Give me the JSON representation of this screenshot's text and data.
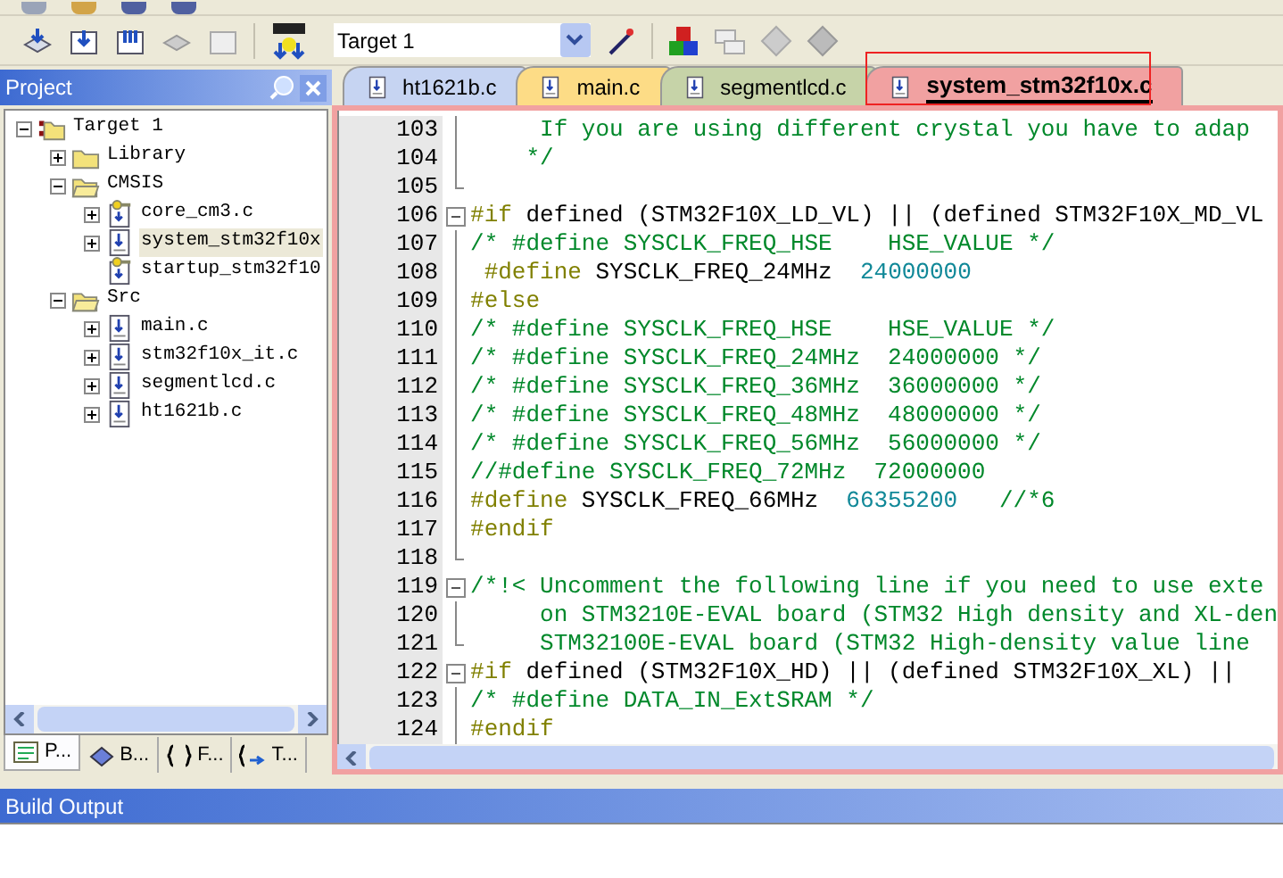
{
  "toolbar": {
    "target_select": {
      "value": "Target 1"
    }
  },
  "project_panel": {
    "title": "Project",
    "tree": [
      {
        "label": "Target 1",
        "kind": "target",
        "expanded": true,
        "selected": false,
        "children": [
          {
            "label": "Library",
            "kind": "folder",
            "expanded": false,
            "selected": false
          },
          {
            "label": "CMSIS",
            "kind": "folder",
            "expanded": true,
            "selected": false,
            "children": [
              {
                "label": "core_cm3.c",
                "kind": "file_options",
                "expanded": false,
                "selected": false
              },
              {
                "label": "system_stm32f10x",
                "kind": "file",
                "expanded": false,
                "selected": true
              },
              {
                "label": "startup_stm32f10",
                "kind": "file_options",
                "selected": false
              }
            ]
          },
          {
            "label": "Src",
            "kind": "folder",
            "expanded": true,
            "selected": false,
            "children": [
              {
                "label": "main.c",
                "kind": "file",
                "expanded": false,
                "selected": false
              },
              {
                "label": "stm32f10x_it.c",
                "kind": "file",
                "expanded": false,
                "selected": false
              },
              {
                "label": "segmentlcd.c",
                "kind": "file",
                "expanded": false,
                "selected": false
              },
              {
                "label": "ht1621b.c",
                "kind": "file",
                "expanded": false,
                "selected": false
              }
            ]
          }
        ]
      }
    ],
    "tabs": [
      {
        "label": "P...",
        "kind": "project",
        "selected": true
      },
      {
        "label": "B...",
        "kind": "books",
        "selected": false
      },
      {
        "label": "F...",
        "kind": "functions",
        "selected": false
      },
      {
        "label": "T...",
        "kind": "templates",
        "selected": false
      }
    ]
  },
  "editor": {
    "tabs": [
      {
        "label": "ht1621b.c",
        "color": "#c6d4f2",
        "selected": false
      },
      {
        "label": "main.c",
        "color": "#fddc86",
        "selected": false
      },
      {
        "label": "segmentlcd.c",
        "color": "#c6d3a8",
        "selected": false
      },
      {
        "label": "system_stm32f10x.c",
        "color": "#f1a1a1",
        "selected": true
      }
    ],
    "lines": [
      {
        "number": "103",
        "kind": "bar",
        "segments": [
          {
            "kind": "comment",
            "text": "     If you are using different crystal you have to adap"
          }
        ]
      },
      {
        "number": "104",
        "kind": "bar",
        "segments": [
          {
            "kind": "comment",
            "text": "    */"
          }
        ]
      },
      {
        "number": "105",
        "kind": "end"
      },
      {
        "number": "106",
        "kind": "open",
        "segments": [
          {
            "kind": "pp",
            "text": "#if"
          },
          {
            "kind": "plain",
            "text": " defined (STM32F10X_LD_VL) || (defined STM32F10X_MD_VL"
          }
        ]
      },
      {
        "number": "107",
        "kind": "bar",
        "segments": [
          {
            "kind": "comment",
            "text": "/* #define SYSCLK_FREQ_HSE    HSE_VALUE */"
          }
        ]
      },
      {
        "number": "108",
        "kind": "bar",
        "segments": [
          {
            "kind": "pp",
            "text": " #define"
          },
          {
            "kind": "plain",
            "text": " SYSCLK_FREQ_24MHz  "
          },
          {
            "kind": "num",
            "text": "24000000"
          }
        ]
      },
      {
        "number": "109",
        "kind": "bar",
        "segments": [
          {
            "kind": "pp",
            "text": "#else"
          }
        ]
      },
      {
        "number": "110",
        "kind": "bar",
        "segments": [
          {
            "kind": "comment",
            "text": "/* #define SYSCLK_FREQ_HSE    HSE_VALUE */"
          }
        ]
      },
      {
        "number": "111",
        "kind": "bar",
        "segments": [
          {
            "kind": "comment",
            "text": "/* #define SYSCLK_FREQ_24MHz  24000000 */"
          }
        ]
      },
      {
        "number": "112",
        "kind": "bar",
        "segments": [
          {
            "kind": "comment",
            "text": "/* #define SYSCLK_FREQ_36MHz  36000000 */"
          }
        ]
      },
      {
        "number": "113",
        "kind": "bar",
        "segments": [
          {
            "kind": "comment",
            "text": "/* #define SYSCLK_FREQ_48MHz  48000000 */"
          }
        ]
      },
      {
        "number": "114",
        "kind": "bar",
        "segments": [
          {
            "kind": "comment",
            "text": "/* #define SYSCLK_FREQ_56MHz  56000000 */"
          }
        ]
      },
      {
        "number": "115",
        "kind": "bar",
        "segments": [
          {
            "kind": "comment",
            "text": "//#define SYSCLK_FREQ_72MHz  72000000"
          }
        ]
      },
      {
        "number": "116",
        "kind": "bar",
        "segments": [
          {
            "kind": "pp",
            "text": "#define"
          },
          {
            "kind": "plain",
            "text": " SYSCLK_FREQ_66MHz  "
          },
          {
            "kind": "num",
            "text": "66355200"
          },
          {
            "kind": "comment",
            "text": "   //*6"
          }
        ]
      },
      {
        "number": "117",
        "kind": "bar",
        "segments": [
          {
            "kind": "pp",
            "text": "#endif"
          }
        ]
      },
      {
        "number": "118",
        "kind": "end"
      },
      {
        "number": "119",
        "kind": "open",
        "segments": [
          {
            "kind": "comment",
            "text": "/*!< Uncomment the following line if you need to use exte"
          }
        ]
      },
      {
        "number": "120",
        "kind": "bar",
        "segments": [
          {
            "kind": "comment",
            "text": "     on STM3210E-EVAL board (STM32 High density and XL-den"
          }
        ]
      },
      {
        "number": "121",
        "kind": "end",
        "segments": [
          {
            "kind": "comment",
            "text": "     STM32100E-EVAL board (STM32 High-density value line"
          }
        ]
      },
      {
        "number": "122",
        "kind": "open",
        "segments": [
          {
            "kind": "pp",
            "text": "#if"
          },
          {
            "kind": "plain",
            "text": " defined (STM32F10X_HD) || (defined STM32F10X_XL) ||"
          }
        ]
      },
      {
        "number": "123",
        "kind": "bar",
        "segments": [
          {
            "kind": "comment",
            "text": "/* #define DATA_IN_ExtSRAM */"
          }
        ]
      },
      {
        "number": "124",
        "kind": "bar",
        "segments": [
          {
            "kind": "pp",
            "text": "#endif"
          }
        ]
      }
    ]
  },
  "build_output": {
    "title": "Build Output"
  }
}
